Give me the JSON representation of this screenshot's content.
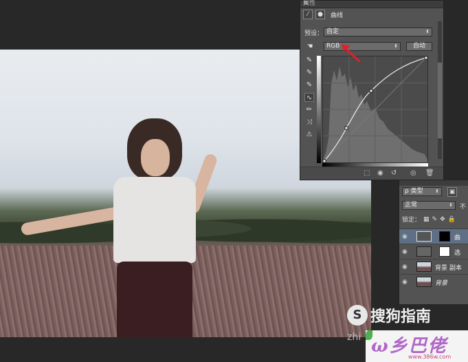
{
  "properties_panel": {
    "tab_title": "属性",
    "adjustment_name": "曲线",
    "preset_label": "预设：",
    "preset_value": "自定",
    "channel_value": "RGB",
    "auto_button": "自动"
  },
  "layers_panel": {
    "filter_value": "ρ 类型",
    "blend_mode": "正常",
    "opacity_label": "不",
    "lock_label": "锁定：",
    "layers": [
      {
        "name": "曲",
        "selected": true
      },
      {
        "name": "选",
        "selected": false
      },
      {
        "name": "背景 副本",
        "selected": false
      },
      {
        "name": "背景",
        "selected": false
      }
    ]
  },
  "watermarks": {
    "sogou_text": "搜狗指南",
    "zhi_text": "zhi",
    "brand_text": "ω乡巴佬",
    "brand_url": "www.386w.com"
  },
  "colors": {
    "panel_bg": "#535353",
    "selected_layer": "#5f6f86",
    "annotation_arrow": "#e0202a"
  }
}
